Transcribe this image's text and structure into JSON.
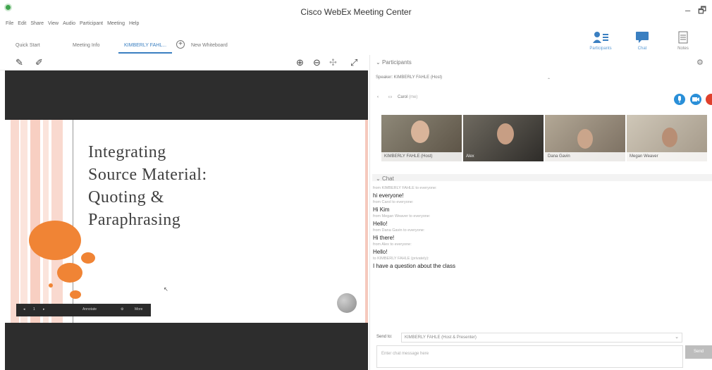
{
  "window": {
    "title": "Cisco WebEx Meeting Center",
    "minimize": "–",
    "maximize": "🗗"
  },
  "menu": [
    "File",
    "Edit",
    "Share",
    "View",
    "Audio",
    "Participant",
    "Meeting",
    "Help"
  ],
  "tabs": [
    {
      "label": "Quick Start",
      "active": false
    },
    {
      "label": "Meeting Info",
      "active": false
    },
    {
      "label": "KIMBERLY FAHL...",
      "active": true
    },
    {
      "label": "New Whiteboard",
      "active": false
    }
  ],
  "add_tab": "+",
  "panel_buttons": {
    "participants": "Participants",
    "chat": "Chat",
    "notes": "Notes"
  },
  "slide": {
    "title_lines": [
      "Integrating",
      "Source Material:",
      "Quoting &",
      "Paraphrasing"
    ]
  },
  "presenter_bar": {
    "page": "1",
    "controls": "Annotate",
    "more": "More"
  },
  "participants": {
    "header": "Participants",
    "speaker": "Speaker: KIMBERLY FAHLE (Host)",
    "current": "Carol",
    "current_tag": "(me)",
    "videos": [
      "KIMBERLY FAHLE (Host)",
      "Alex",
      "Dana Gavin",
      "Megan Weaver"
    ]
  },
  "chat": {
    "header": "Chat",
    "messages": [
      {
        "meta": "from KIMBERLY FAHLE to everyone:",
        "text": "hi everyone!"
      },
      {
        "meta": "from Carol to everyone:",
        "text": "Hi Kim"
      },
      {
        "meta": "from Megan Weaver to everyone:",
        "text": "Hello!"
      },
      {
        "meta": "from Dana Gavin to everyone:",
        "text": "Hi there!"
      },
      {
        "meta": "from Alex to everyone:",
        "text": "Hello!"
      },
      {
        "meta": "to KIMBERLY FAHLE (privately):",
        "text": "I have a question  about the class"
      }
    ],
    "send_to_label": "Send to:",
    "send_to_value": "KIMBERLY FAHLE (Host & Presenter)",
    "input_placeholder": "Enter chat message here",
    "send_label": "Send"
  },
  "colors": {
    "accent": "#3a7fc1",
    "slide_orange": "#f08435",
    "stage_dark": "#2d2d2d"
  }
}
